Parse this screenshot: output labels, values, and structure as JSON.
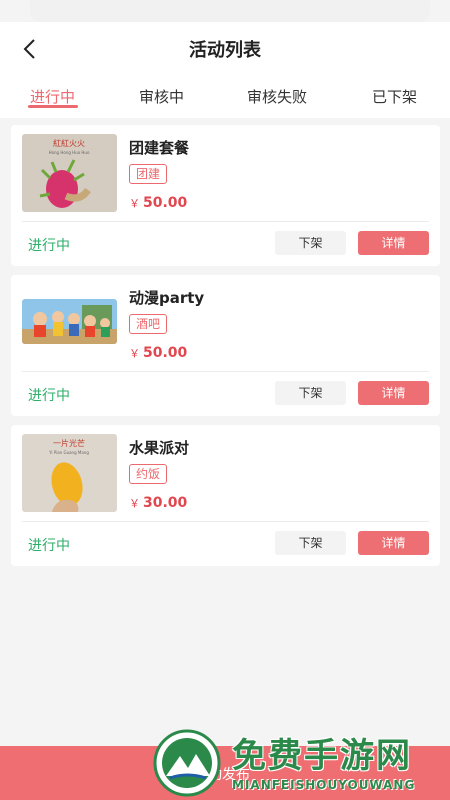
{
  "header": {
    "title": "活动列表",
    "back_icon": "chevron-left-icon"
  },
  "tabs": [
    {
      "label": "进行中",
      "active": true
    },
    {
      "label": "审核中",
      "active": false
    },
    {
      "label": "审核失败",
      "active": false
    },
    {
      "label": "已下架",
      "active": false
    }
  ],
  "activities": [
    {
      "title": "团建套餐",
      "tag": "团建",
      "currency": "￥",
      "price": "50.00",
      "status": "进行中",
      "off_label": "下架",
      "detail_label": "详情",
      "image_caption": "紅紅火火",
      "image_subcaption": "Hong Hong Huo Huo"
    },
    {
      "title": "动漫party",
      "tag": "酒吧",
      "currency": "￥",
      "price": "50.00",
      "status": "进行中",
      "off_label": "下架",
      "detail_label": "详情"
    },
    {
      "title": "水果派对",
      "tag": "约饭",
      "currency": "￥",
      "price": "30.00",
      "status": "进行中",
      "off_label": "下架",
      "detail_label": "详情",
      "image_caption": "一片光芒",
      "image_subcaption": "Yi Pian Guang Mang"
    }
  ],
  "bottom_bar": {
    "label": "动发布"
  },
  "watermark": {
    "text": "免费手游网",
    "subtext": "MIANFEISHOUYOUWANG"
  },
  "colors": {
    "accent": "#ec6a6f",
    "status_green": "#2fae6a",
    "price_red": "#e0474f"
  }
}
